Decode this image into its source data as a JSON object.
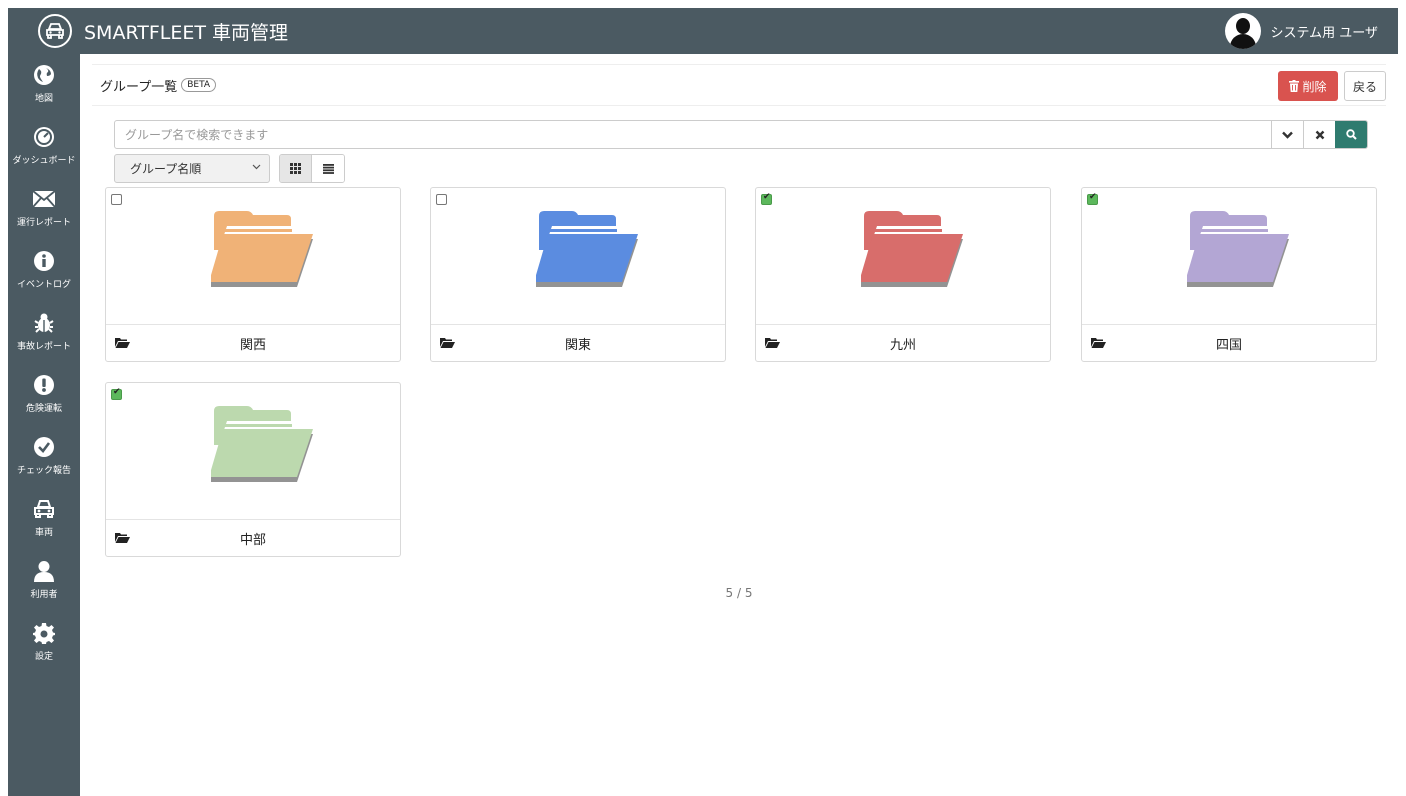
{
  "app": {
    "title": "SMARTFLEET 車両管理",
    "logo_icon": "car-icon"
  },
  "user": {
    "name": "システム用 ユーザ",
    "avatar_icon": "user-avatar-icon"
  },
  "sidebar": {
    "items": [
      {
        "label": "地図",
        "icon": "globe-icon"
      },
      {
        "label": "ダッシュボード",
        "icon": "dashboard-icon"
      },
      {
        "label": "運行レポート",
        "icon": "envelope-icon"
      },
      {
        "label": "イベントログ",
        "icon": "info-icon"
      },
      {
        "label": "事故レポート",
        "icon": "bug-icon"
      },
      {
        "label": "危険運転",
        "icon": "exclamation-icon"
      },
      {
        "label": "チェック報告",
        "icon": "check-icon"
      },
      {
        "label": "車両",
        "icon": "car-icon"
      },
      {
        "label": "利用者",
        "icon": "user-icon"
      },
      {
        "label": "設定",
        "icon": "gear-icon"
      }
    ]
  },
  "header": {
    "title": "グループ一覧",
    "beta_badge": "BETA",
    "delete_label": "削除",
    "back_label": "戻る"
  },
  "search": {
    "placeholder": "グループ名で検索できます",
    "value": ""
  },
  "sort": {
    "selected": "グループ名順"
  },
  "view": {
    "mode": "grid"
  },
  "groups": [
    {
      "name": "関西",
      "checked": false,
      "color": "#f0b277"
    },
    {
      "name": "関東",
      "checked": false,
      "color": "#5b8ce0"
    },
    {
      "name": "九州",
      "checked": true,
      "color": "#d86d6b"
    },
    {
      "name": "四国",
      "checked": true,
      "color": "#b3a6d4"
    },
    {
      "name": "中部",
      "checked": true,
      "color": "#bcd9ae"
    }
  ],
  "pagination": {
    "label": "5 / 5"
  },
  "colors": {
    "sidebar": "#4b5a62",
    "danger": "#d9534f",
    "search_go": "#2f7b6f",
    "checked": "#5cb85c"
  }
}
